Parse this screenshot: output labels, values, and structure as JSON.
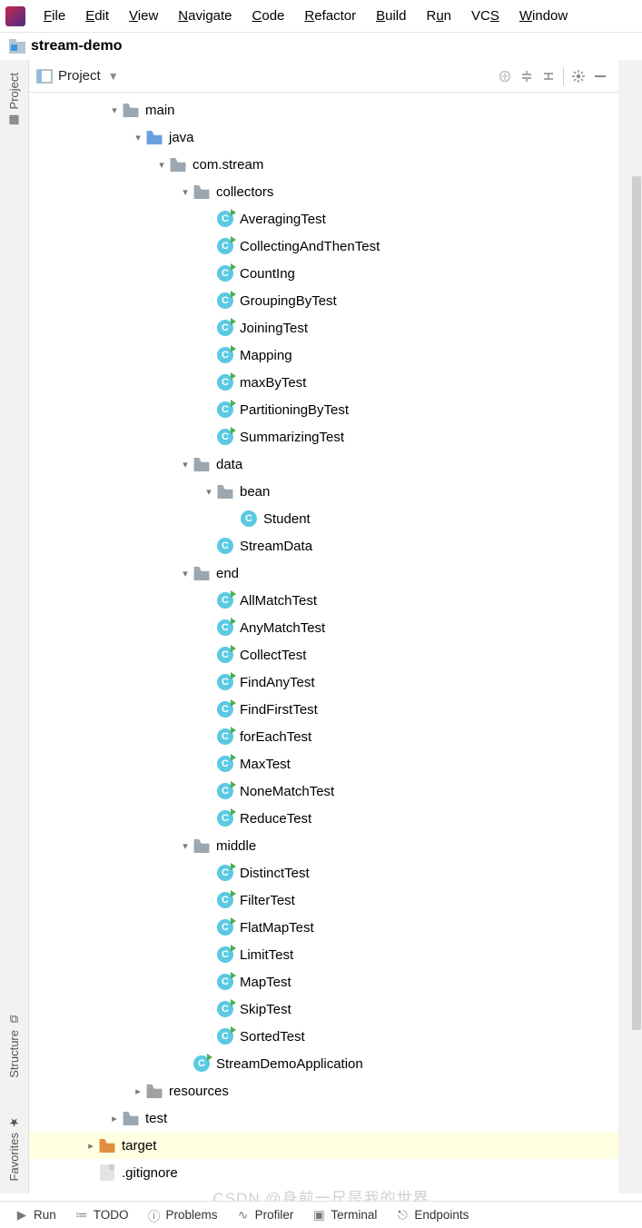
{
  "menu": [
    "File",
    "Edit",
    "View",
    "Navigate",
    "Code",
    "Refactor",
    "Build",
    "Run",
    "VCS",
    "Window"
  ],
  "menuUnderline": [
    0,
    0,
    0,
    0,
    0,
    0,
    0,
    1,
    2,
    0
  ],
  "breadcrumb": {
    "project": "stream-demo"
  },
  "panel": {
    "title": "Project"
  },
  "sideTabs": {
    "top": "Project",
    "bot1": "Structure",
    "bot2": "Favorites"
  },
  "tree": [
    {
      "d": 3,
      "a": "exp",
      "i": "folder",
      "t": "main"
    },
    {
      "d": 4,
      "a": "exp",
      "i": "folder-src",
      "t": "java"
    },
    {
      "d": 5,
      "a": "exp",
      "i": "folder-pkg",
      "t": "com.stream"
    },
    {
      "d": 6,
      "a": "exp",
      "i": "folder-pkg",
      "t": "collectors"
    },
    {
      "d": 7,
      "a": "none",
      "i": "class-run",
      "t": "AveragingTest"
    },
    {
      "d": 7,
      "a": "none",
      "i": "class-run",
      "t": "CollectingAndThenTest"
    },
    {
      "d": 7,
      "a": "none",
      "i": "class-run",
      "t": "CountIng"
    },
    {
      "d": 7,
      "a": "none",
      "i": "class-run",
      "t": "GroupingByTest"
    },
    {
      "d": 7,
      "a": "none",
      "i": "class-run",
      "t": "JoiningTest"
    },
    {
      "d": 7,
      "a": "none",
      "i": "class-run",
      "t": "Mapping"
    },
    {
      "d": 7,
      "a": "none",
      "i": "class-run",
      "t": "maxByTest"
    },
    {
      "d": 7,
      "a": "none",
      "i": "class-run",
      "t": "PartitioningByTest"
    },
    {
      "d": 7,
      "a": "none",
      "i": "class-run",
      "t": "SummarizingTest"
    },
    {
      "d": 6,
      "a": "exp",
      "i": "folder-pkg",
      "t": "data"
    },
    {
      "d": 7,
      "a": "exp",
      "i": "folder-pkg",
      "t": "bean"
    },
    {
      "d": 8,
      "a": "none",
      "i": "class",
      "t": "Student"
    },
    {
      "d": 7,
      "a": "none",
      "i": "class",
      "t": "StreamData"
    },
    {
      "d": 6,
      "a": "exp",
      "i": "folder-pkg",
      "t": "end"
    },
    {
      "d": 7,
      "a": "none",
      "i": "class-run",
      "t": "AllMatchTest"
    },
    {
      "d": 7,
      "a": "none",
      "i": "class-run",
      "t": "AnyMatchTest"
    },
    {
      "d": 7,
      "a": "none",
      "i": "class-run",
      "t": "CollectTest"
    },
    {
      "d": 7,
      "a": "none",
      "i": "class-run",
      "t": "FindAnyTest"
    },
    {
      "d": 7,
      "a": "none",
      "i": "class-run",
      "t": "FindFirstTest"
    },
    {
      "d": 7,
      "a": "none",
      "i": "class-run",
      "t": "forEachTest"
    },
    {
      "d": 7,
      "a": "none",
      "i": "class-run",
      "t": "MaxTest"
    },
    {
      "d": 7,
      "a": "none",
      "i": "class-run",
      "t": "NoneMatchTest"
    },
    {
      "d": 7,
      "a": "none",
      "i": "class-run",
      "t": "ReduceTest"
    },
    {
      "d": 6,
      "a": "exp",
      "i": "folder-pkg",
      "t": "middle"
    },
    {
      "d": 7,
      "a": "none",
      "i": "class-run",
      "t": "DistinctTest"
    },
    {
      "d": 7,
      "a": "none",
      "i": "class-run",
      "t": "FilterTest"
    },
    {
      "d": 7,
      "a": "none",
      "i": "class-run",
      "t": "FlatMapTest"
    },
    {
      "d": 7,
      "a": "none",
      "i": "class-run",
      "t": "LimitTest"
    },
    {
      "d": 7,
      "a": "none",
      "i": "class-run",
      "t": "MapTest"
    },
    {
      "d": 7,
      "a": "none",
      "i": "class-run",
      "t": "SkipTest"
    },
    {
      "d": 7,
      "a": "none",
      "i": "class-run",
      "t": "SortedTest"
    },
    {
      "d": 6,
      "a": "none",
      "i": "class-run",
      "t": "StreamDemoApplication"
    },
    {
      "d": 4,
      "a": "col",
      "i": "folder-res",
      "t": "resources"
    },
    {
      "d": 3,
      "a": "col",
      "i": "folder",
      "t": "test"
    },
    {
      "d": 2,
      "a": "col",
      "i": "folder-tgt",
      "t": "target",
      "hl": true
    },
    {
      "d": 2,
      "a": "none",
      "i": "file",
      "t": ".gitignore"
    }
  ],
  "status": [
    {
      "icon": "play",
      "label": "Run"
    },
    {
      "icon": "list",
      "label": "TODO"
    },
    {
      "icon": "info",
      "label": "Problems"
    },
    {
      "icon": "pulse",
      "label": "Profiler"
    },
    {
      "icon": "term",
      "label": "Terminal"
    },
    {
      "icon": "ep",
      "label": "Endpoints"
    }
  ],
  "watermark": "CSDN @身前一尺是我的世界"
}
